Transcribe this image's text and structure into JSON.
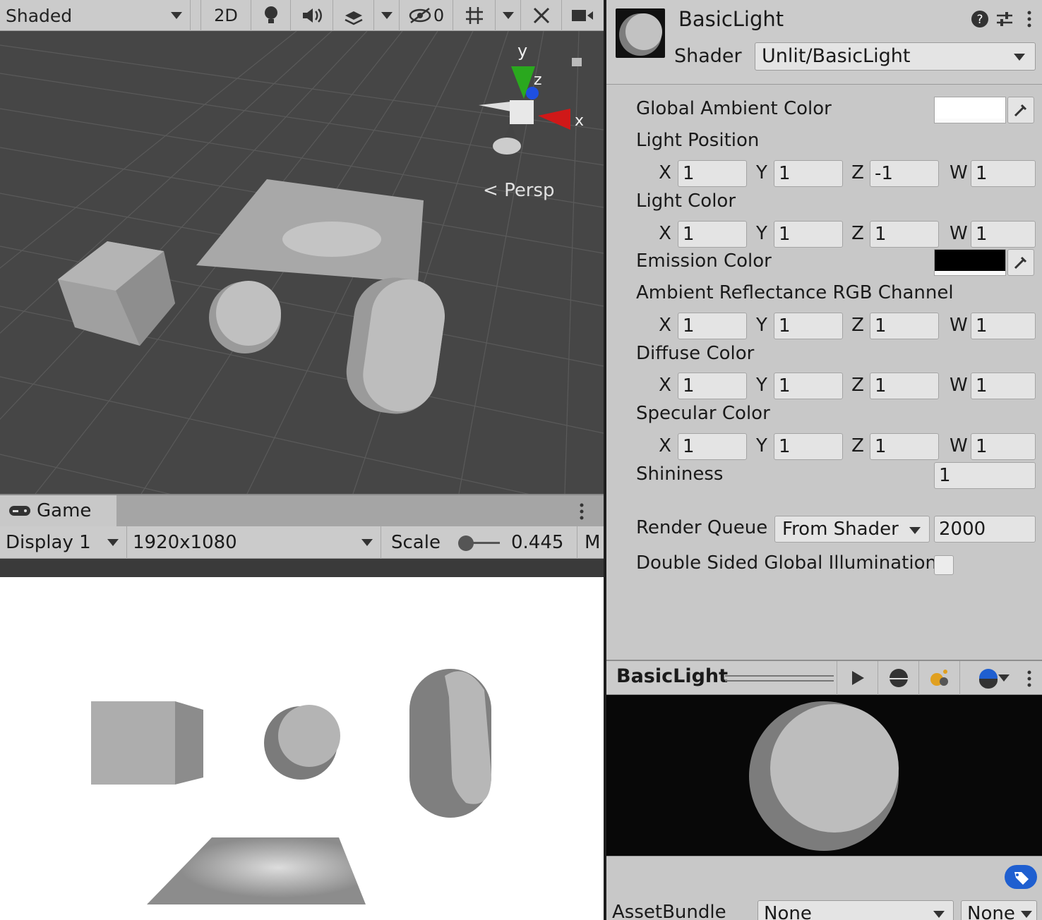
{
  "scene": {
    "toolbar": {
      "draw_mode": "Shaded",
      "mode_2d": "2D",
      "hidden_count": "0"
    },
    "gizmo": {
      "y": "y",
      "z": "z",
      "x": "x",
      "projection": "Persp"
    }
  },
  "game": {
    "tab_label": "Game",
    "display": "Display 1",
    "resolution": "1920x1080",
    "scale_label": "Scale",
    "scale_value": "0.445",
    "maximize_partial": "M",
    "scale_slider_fraction": 0.1
  },
  "inspector": {
    "material_name": "BasicLight",
    "shader_label": "Shader",
    "shader_value": "Unlit/BasicLight",
    "properties": {
      "global_ambient_color": {
        "label": "Global Ambient Color",
        "color": "#ffffff"
      },
      "light_position": {
        "label": "Light Position",
        "x": "1",
        "y": "1",
        "z": "-1",
        "w": "1"
      },
      "light_color": {
        "label": "Light Color",
        "x": "1",
        "y": "1",
        "z": "1",
        "w": "1"
      },
      "emission_color": {
        "label": "Emission Color",
        "color": "#000000"
      },
      "ambient_reflectance": {
        "label": "Ambient Reflectance RGB Channel",
        "x": "1",
        "y": "1",
        "z": "1",
        "w": "1"
      },
      "diffuse_color": {
        "label": "Diffuse Color",
        "x": "1",
        "y": "1",
        "z": "1",
        "w": "1"
      },
      "specular_color": {
        "label": "Specular Color",
        "x": "1",
        "y": "1",
        "z": "1",
        "w": "1"
      },
      "shininess": {
        "label": "Shininess",
        "value": "1"
      }
    },
    "render_queue": {
      "label": "Render Queue",
      "mode": "From Shader",
      "value": "2000"
    },
    "double_sided_gi": {
      "label": "Double Sided Global Illumination",
      "checked": false
    },
    "axis_labels": {
      "x": "X",
      "y": "Y",
      "z": "Z",
      "w": "W"
    }
  },
  "preview": {
    "title": "BasicLight"
  },
  "assetbundle": {
    "label": "AssetBundle",
    "name": "None",
    "variant": "None"
  },
  "colors": {
    "gizmo_y": "#2aa81e",
    "gizmo_z": "#1e4fe0",
    "gizmo_x": "#d01818",
    "tag_icon": "#1f5fd0",
    "lighting_icon": "#e0a020"
  }
}
